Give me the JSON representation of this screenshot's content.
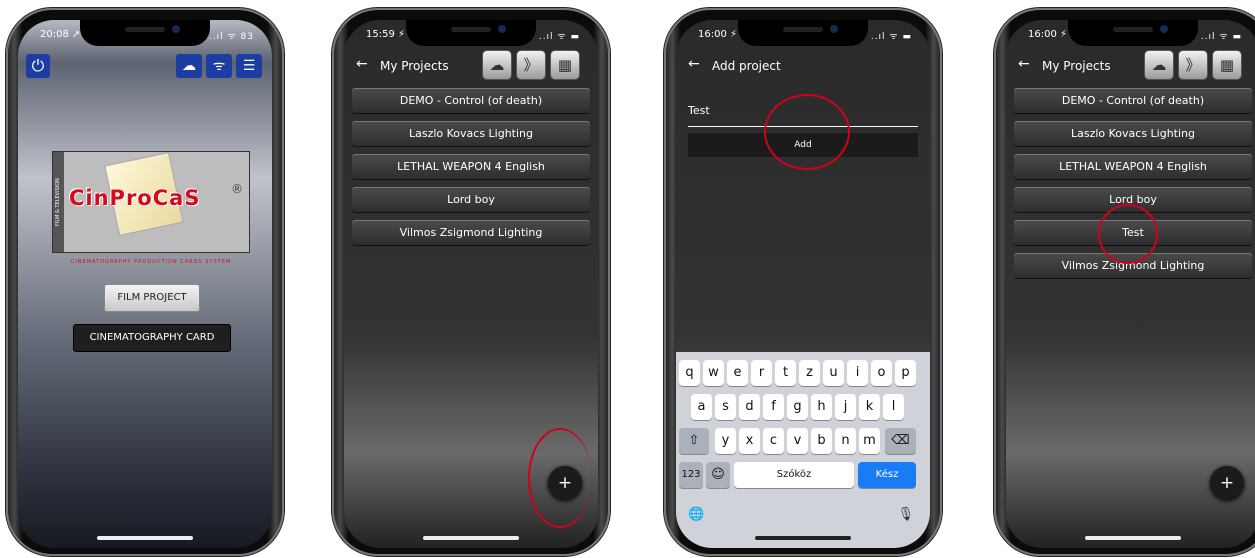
{
  "phone1": {
    "status_time": "20:08 ➚",
    "status_icons": "..ıl ᯤ 83",
    "power_glyph": "⏻",
    "toolbar_glyphs": [
      "☁",
      "ᯤ",
      "☰"
    ],
    "logo_brand": "CinProCaS",
    "logo_side": "FILM & TELEVISION",
    "logo_reg": "®",
    "logo_tagline": "CINEMATOGRAPHY PRODUCTION CARDS SYSTEM",
    "film_project_label": "FILM PROJECT",
    "cine_card_label": "CINEMATOGRAPHY CARD"
  },
  "phone2": {
    "status_time": "15:59 ⚡",
    "status_icons": "..ıl ᯤ ▬",
    "title": "My Projects",
    "back_glyph": "←",
    "toolbar_glyphs": [
      "☁",
      "》",
      "▦"
    ],
    "projects": [
      "DEMO - Control (of death)",
      "Laszlo Kovacs Lighting",
      "LETHAL WEAPON 4 English",
      "Lord boy",
      "Vilmos Zsigmond Lighting"
    ],
    "fab_glyph": "+"
  },
  "phone3": {
    "status_time": "16:00 ⚡",
    "status_icons": "..ıl ᯤ ▬",
    "title": "Add project",
    "back_glyph": "←",
    "input_value": "Test",
    "add_label": "Add",
    "keyboard": {
      "row1": [
        "q",
        "w",
        "e",
        "r",
        "t",
        "z",
        "u",
        "i",
        "o",
        "p"
      ],
      "row2": [
        "a",
        "s",
        "d",
        "f",
        "g",
        "h",
        "j",
        "k",
        "l"
      ],
      "row3": [
        "y",
        "x",
        "c",
        "v",
        "b",
        "n",
        "m"
      ],
      "shift": "⇧",
      "backspace": "⌫",
      "numbers": "123",
      "emoji": "☺",
      "space": "Szóköz",
      "done": "Kész",
      "globe": "🌐",
      "mic": "🎙"
    }
  },
  "phone4": {
    "status_time": "16:00 ⚡",
    "status_icons": "..ıl ᯤ ▬",
    "title": "My Projects",
    "back_glyph": "←",
    "toolbar_glyphs": [
      "☁",
      "》",
      "▦"
    ],
    "projects": [
      "DEMO - Control (of death)",
      "Laszlo Kovacs Lighting",
      "LETHAL WEAPON 4 English",
      "Lord boy",
      "Test",
      "Vilmos Zsigmond Lighting"
    ],
    "fab_glyph": "+"
  }
}
